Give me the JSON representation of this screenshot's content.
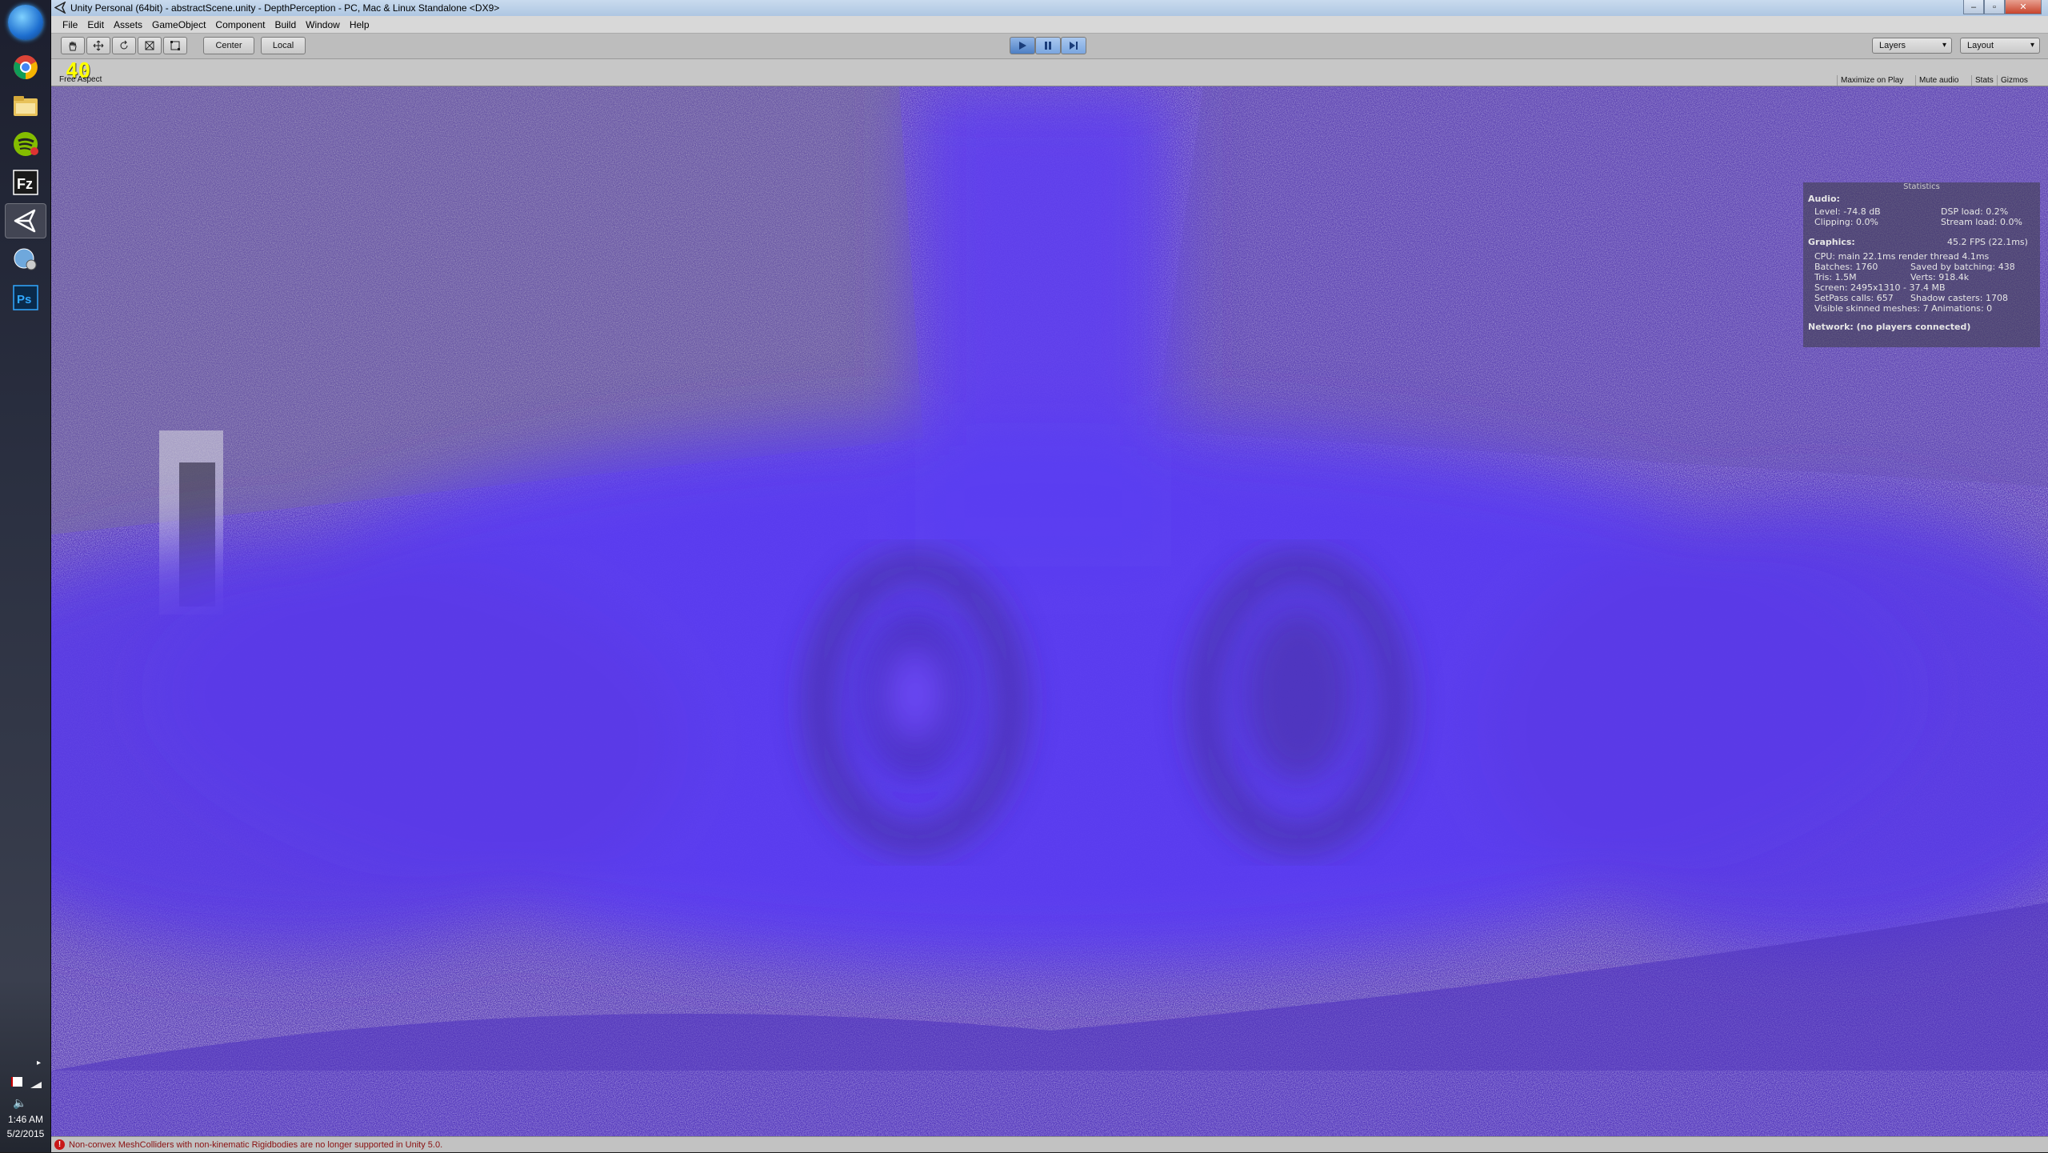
{
  "window": {
    "title": "Unity Personal (64bit) - abstractScene.unity - DepthPerception - PC, Mac & Linux Standalone <DX9>"
  },
  "menu": [
    "File",
    "Edit",
    "Assets",
    "GameObject",
    "Component",
    "Build",
    "Window",
    "Help"
  ],
  "toolbar": {
    "tools": [
      "hand-icon",
      "move-icon",
      "rotate-icon",
      "scale-icon",
      "rect-icon"
    ],
    "pivot_label": "Center",
    "space_label": "Local",
    "layers_label": "Layers",
    "layout_label": "Layout"
  },
  "game_view": {
    "fps_overlay": "40",
    "aspect": "Free Aspect",
    "buttons": [
      "Maximize on Play",
      "Mute audio",
      "Stats",
      "Gizmos"
    ]
  },
  "stats": {
    "title": "Statistics",
    "audio_heading": "Audio:",
    "level": "Level: -74.8 dB",
    "clipping": "Clipping: 0.0%",
    "dsp_load": "DSP load: 0.2%",
    "stream_load": "Stream load: 0.0%",
    "graphics_heading": "Graphics:",
    "fps": "45.2 FPS (22.1ms)",
    "cpu": "CPU: main 22.1ms  render thread 4.1ms",
    "batches": "Batches: 1760",
    "saved_batching": "Saved by batching: 438",
    "tris": "Tris: 1.5M",
    "verts": "Verts: 918.4k",
    "screen": "Screen: 2495x1310 - 37.4 MB",
    "setpass": "SetPass calls: 657",
    "shadow_casters": "Shadow casters: 1708",
    "skinned": "Visible skinned meshes: 7  Animations: 0",
    "network": "Network: (no players connected)"
  },
  "status_bar": {
    "message": "Non-convex MeshColliders with non-kinematic Rigidbodies are no longer supported in Unity 5.0."
  },
  "taskbar": {
    "apps": [
      "chrome-icon",
      "file-explorer-icon",
      "spotify-icon",
      "filezilla-icon",
      "unity-icon",
      "network-icon",
      "photoshop-icon"
    ],
    "time": "1:46 AM",
    "date": "5/2/2015"
  }
}
